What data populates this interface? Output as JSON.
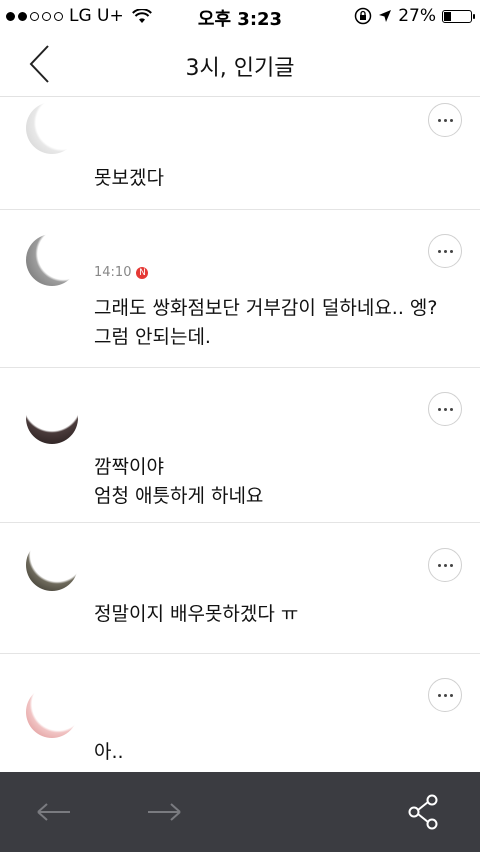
{
  "status_bar": {
    "carrier": "LG U+",
    "time": "오후 3:23",
    "battery": "27%",
    "battery_level": 0.27
  },
  "header": {
    "title": "3시, 인기글"
  },
  "comments": [
    {
      "meta": "",
      "text": "못보겠다"
    },
    {
      "meta": "14:10",
      "text": "그래도 쌍화점보단 거부감이 덜하네요.. 엥?\n그럼 안되는데."
    },
    {
      "meta": "",
      "text": "깜짝이야\n엄청 애틋하게 하네요"
    },
    {
      "meta": "",
      "text": "정말이지 배우못하겠다 ㅠ"
    },
    {
      "meta": "",
      "text": "아.."
    }
  ],
  "icons": {
    "back": "back-chevron-icon",
    "more": "more-dots-icon",
    "prev": "arrow-left-icon",
    "next": "arrow-right-icon",
    "share": "share-icon"
  },
  "colors": {
    "toolbar_bg": "#3b3c41",
    "badge": "#e53935"
  }
}
